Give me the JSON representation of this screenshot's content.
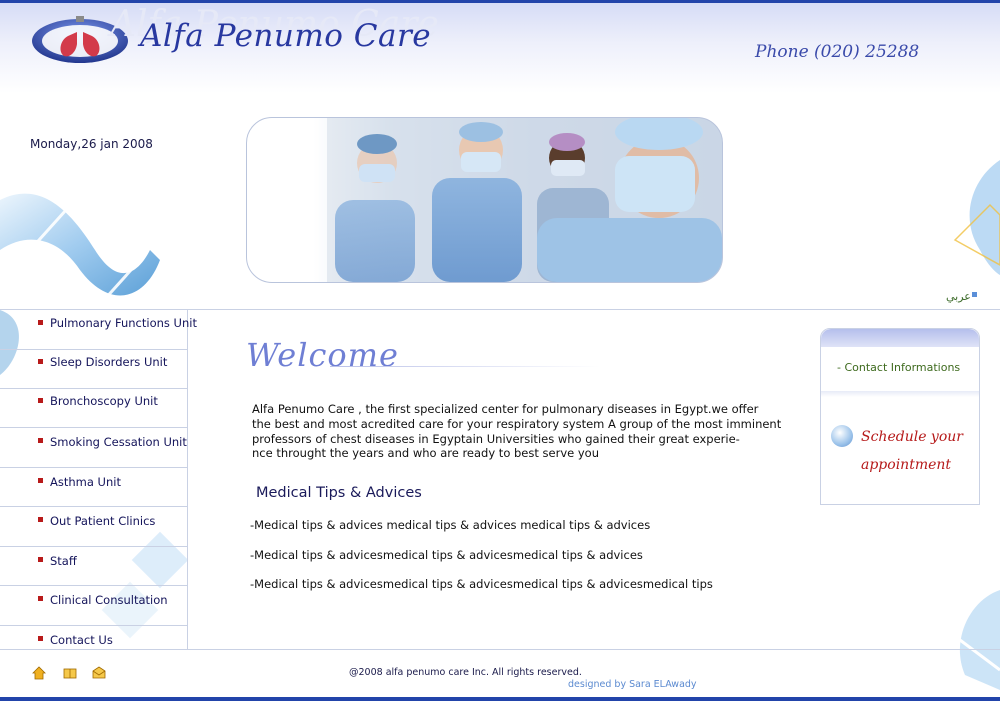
{
  "brand": {
    "name": "Alfa Penumo Care",
    "phone": "Phone (020) 25288"
  },
  "date": "Monday,26 jan 2008",
  "lang_link": "عربي",
  "nav": {
    "items": [
      {
        "label": "Pulmonary Functions Unit"
      },
      {
        "label": "Sleep Disorders Unit"
      },
      {
        "label": "Bronchoscopy Unit"
      },
      {
        "label": "Smoking Cessation Unit"
      },
      {
        "label": "Asthma Unit"
      },
      {
        "label": "Out Patient Clinics"
      },
      {
        "label": "Staff"
      },
      {
        "label": "Clinical Consultation"
      },
      {
        "label": "Contact Us"
      }
    ]
  },
  "main": {
    "welcome": "Welcome",
    "intro_lines": [
      "Alfa Penumo Care , the first specialized center for pulmonary diseases in Egypt.we offer",
      "the best  and most acredited care for your respiratory system A group of the most imminent",
      "professors of chest diseases in Egyptain Universities who gained their great experie-",
      "nce throught the years and who are ready to best serve you"
    ],
    "tips_heading": "Medical Tips & Advices",
    "tips": [
      "-Medical tips & advices  medical tips & advices medical tips & advices",
      "-Medical tips & advicesmedical tips & advicesmedical tips & advices",
      "-Medical tips & advicesmedical tips & advicesmedical tips & advicesmedical tips"
    ]
  },
  "sidebar_right": {
    "contact_link": "- Contact Informations",
    "schedule": "Schedule your appointment"
  },
  "footer": {
    "copyright": "@2008 alfa penumo care Inc. All rights reserved.",
    "designer": "designed by Sara ELAwady",
    "icons": [
      "home-icon",
      "book-icon",
      "mail-icon"
    ]
  },
  "colors": {
    "brand": "#2838a0",
    "accent": "#6f7fd4",
    "nav_bullet": "#b81a1a",
    "schedule": "#b61a1a",
    "rule": "#2244aa"
  }
}
